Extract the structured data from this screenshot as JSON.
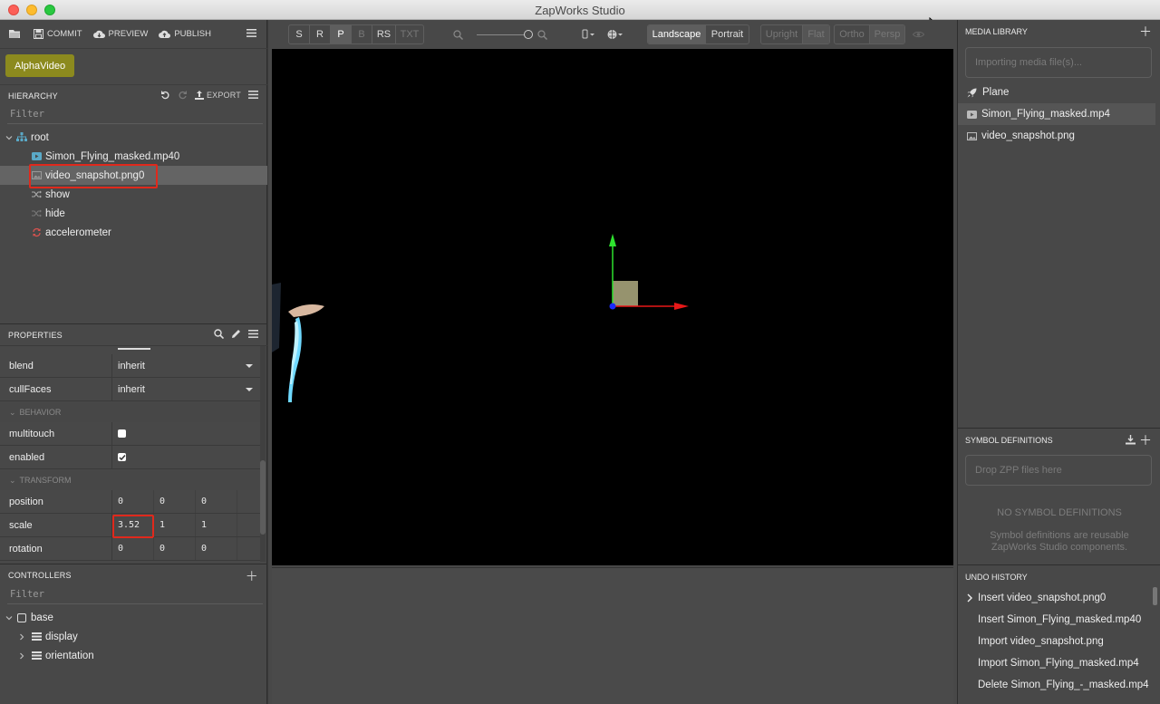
{
  "window": {
    "title": "ZapWorks Studio"
  },
  "toolbar": {
    "commit": "COMMIT",
    "preview": "PREVIEW",
    "publish": "PUBLISH"
  },
  "project": {
    "name": "AlphaVideo"
  },
  "hierarchy": {
    "title": "HIERARCHY",
    "export": "EXPORT",
    "filter_placeholder": "Filter",
    "root": "root",
    "items": [
      {
        "label": "Simon_Flying_masked.mp40",
        "icon": "video-icon"
      },
      {
        "label": "video_snapshot.png0",
        "icon": "image-icon",
        "selected": true
      },
      {
        "label": "show",
        "icon": "shuffle-icon"
      },
      {
        "label": "hide",
        "icon": "shuffle-icon"
      },
      {
        "label": "accelerometer",
        "icon": "refresh-icon"
      }
    ]
  },
  "properties": {
    "title": "PROPERTIES",
    "blend": {
      "label": "blend",
      "value": "inherit"
    },
    "cullFaces": {
      "label": "cullFaces",
      "value": "inherit"
    },
    "behavior_section": "BEHAVIOR",
    "multitouch": {
      "label": "multitouch",
      "checked": false
    },
    "enabled": {
      "label": "enabled",
      "checked": true
    },
    "transform_section": "TRANSFORM",
    "position": {
      "label": "position",
      "x": "0",
      "y": "0",
      "z": "0"
    },
    "scale": {
      "label": "scale",
      "x": "3.52",
      "y": "1",
      "z": "1"
    },
    "rotation": {
      "label": "rotation",
      "x": "0",
      "y": "0",
      "z": "0"
    }
  },
  "controllers": {
    "title": "CONTROLLERS",
    "filter_placeholder": "Filter",
    "base": "base",
    "children": [
      "display",
      "orientation"
    ]
  },
  "viewport_toolbar": {
    "modes": [
      "S",
      "R",
      "P",
      "B",
      "RS",
      "TXT"
    ],
    "active_mode": "P",
    "orientation": [
      "Landscape",
      "Portrait"
    ],
    "orientation_active": "Landscape",
    "view": [
      "Upright",
      "Flat"
    ],
    "projection": [
      "Ortho",
      "Persp"
    ]
  },
  "media_library": {
    "title": "MEDIA LIBRARY",
    "importing": "Importing media file(s)...",
    "items": [
      {
        "label": "Plane",
        "icon": "rocket-icon"
      },
      {
        "label": "Simon_Flying_masked.mp4",
        "icon": "video-icon",
        "selected": true
      },
      {
        "label": "video_snapshot.png",
        "icon": "image-icon"
      }
    ]
  },
  "symbol_definitions": {
    "title": "SYMBOL DEFINITIONS",
    "drop": "Drop ZPP files here",
    "empty_title": "NO SYMBOL DEFINITIONS",
    "empty_desc": "Symbol definitions are reusable ZapWorks Studio components."
  },
  "undo_history": {
    "title": "UNDO HISTORY",
    "items": [
      "Insert video_snapshot.png0",
      "Insert Simon_Flying_masked.mp40",
      "Import video_snapshot.png",
      "Import Simon_Flying_masked.mp4",
      "Delete Simon_Flying_-_masked.mp4"
    ]
  },
  "colors": {
    "accent": "#8c8a1e",
    "highlight": "#e0291c",
    "axis_x": "#e81818",
    "axis_y": "#2ee22e",
    "axis_z": "#1a2cff"
  }
}
